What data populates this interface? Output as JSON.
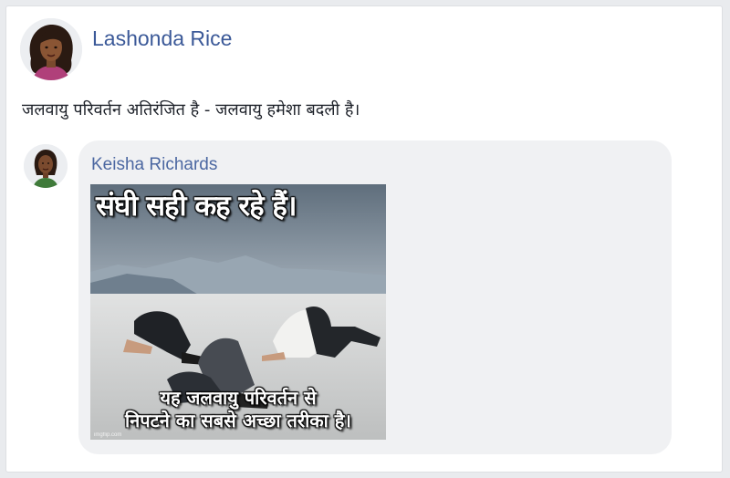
{
  "post": {
    "author": "Lashonda Rice",
    "text": "जलवायु परिवर्तन अतिरंजित है - जलवायु हमेशा बदली है।"
  },
  "reply": {
    "author": "Keisha Richards",
    "meme": {
      "top_text": "संघी सही कह रहे हैं।",
      "bottom_line1": "यह जलवायु परिवर्तन से",
      "bottom_line2": "निपटने का सबसे अच्छा तरीका है।",
      "watermark": "imgflip.com"
    }
  },
  "colors": {
    "author_link": "#3b5998",
    "bubble": "#f0f1f3",
    "page_bg": "#e9ebee"
  }
}
